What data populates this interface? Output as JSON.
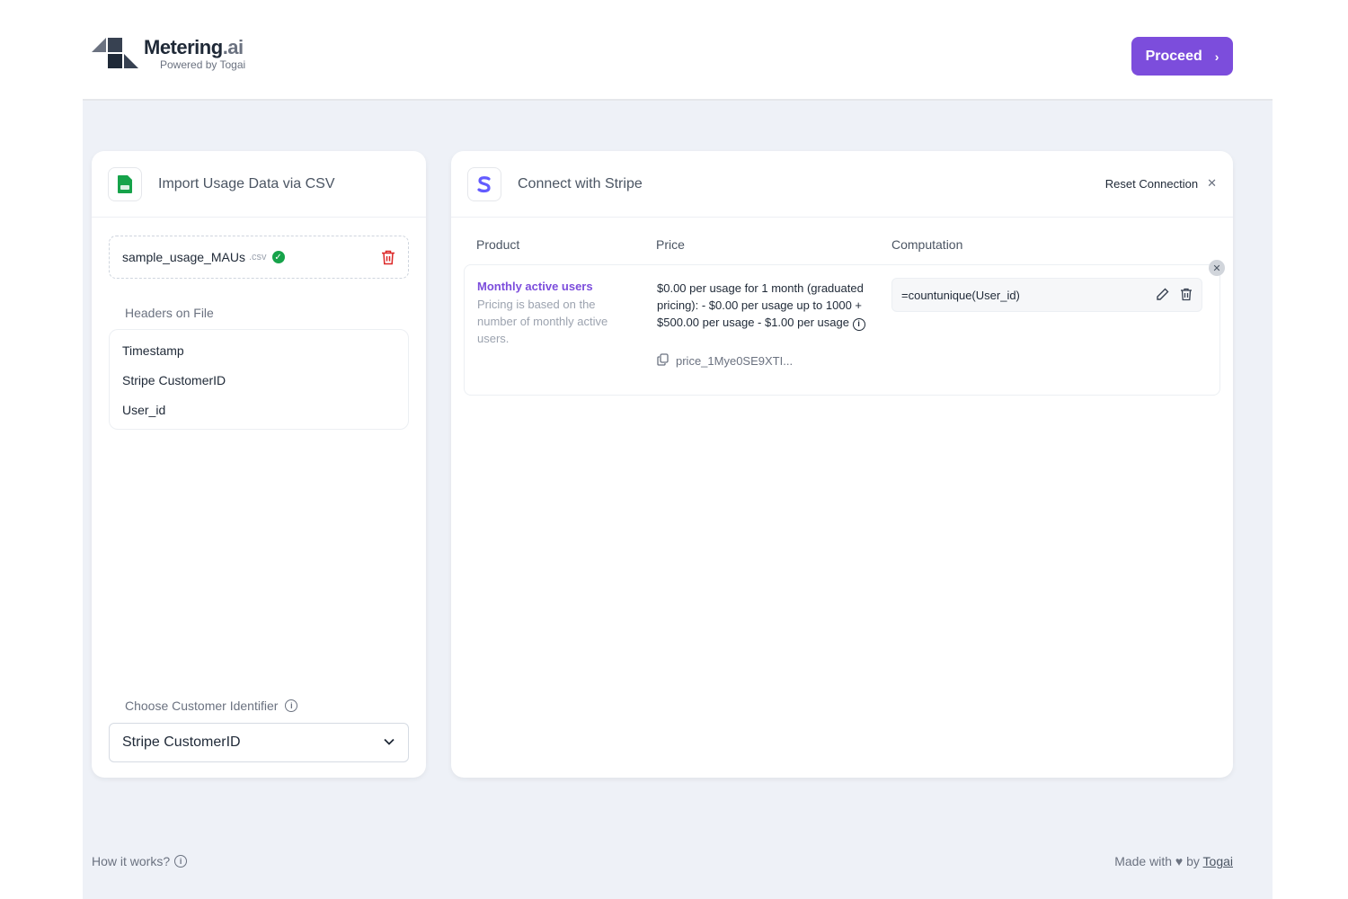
{
  "brand": {
    "name": "Metering",
    "name_suffix": ".ai",
    "tagline": "Powered by Togai"
  },
  "header": {
    "proceed_label": "Proceed"
  },
  "import_card": {
    "title": "Import Usage Data via CSV",
    "file": {
      "name": "sample_usage_MAUs",
      "ext": ".csv"
    },
    "headers_label": "Headers on File",
    "headers": [
      "Timestamp",
      "Stripe CustomerID",
      "User_id"
    ],
    "choose_label": "Choose Customer Identifier",
    "selected_identifier": "Stripe CustomerID"
  },
  "stripe_card": {
    "title": "Connect with Stripe",
    "reset_label": "Reset Connection",
    "columns": {
      "product": "Product",
      "price": "Price",
      "computation": "Computation"
    },
    "row": {
      "product_name": "Monthly active users",
      "product_desc": "Pricing is based on the number of monthly active users.",
      "price_text": "$0.00 per usage for 1 month (graduated pricing): - $0.00 per usage up to 1000 + $500.00 per usage - $1.00 per usage",
      "price_id": "price_1Mye0SE9XTI...",
      "computation": "=countunique(User_id)"
    }
  },
  "footer": {
    "how_it_works": "How it works?",
    "made_with": "Made with",
    "by": "by",
    "company": "Togai"
  },
  "colors": {
    "accent": "#7c4ddc",
    "success": "#16a34a",
    "danger": "#dc2626",
    "background": "#eef1f7"
  }
}
